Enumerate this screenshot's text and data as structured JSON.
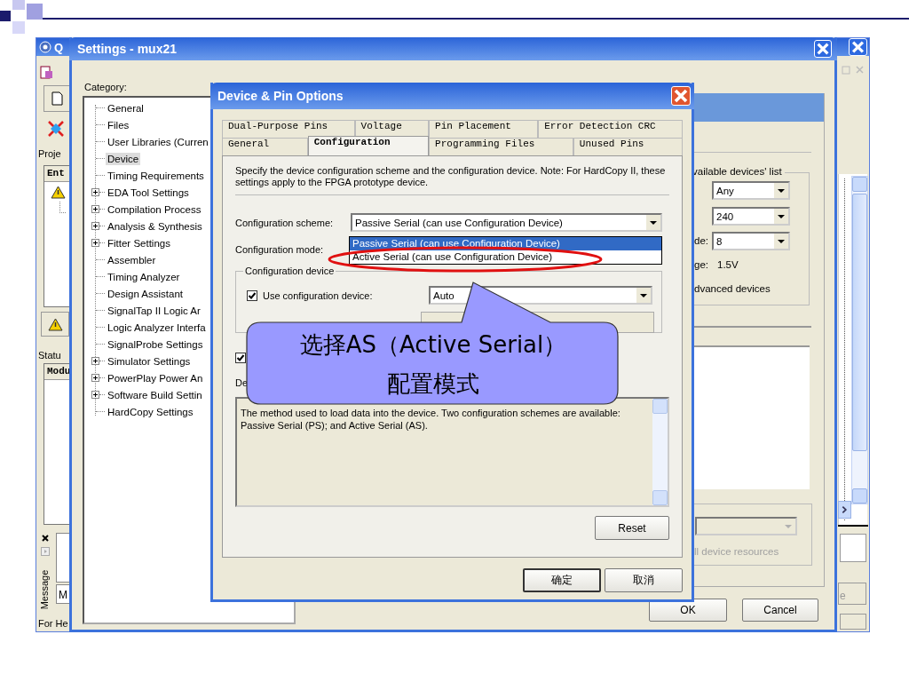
{
  "main_window": {
    "title": "Q",
    "project_label": "Proje",
    "entity_header": "Ent",
    "status_label": "Statu",
    "module_header": "Modu",
    "messages_label": "Message",
    "message_field": "M",
    "help_label": "For He",
    "button_fragment": "e"
  },
  "settings_window": {
    "title": "Settings - mux21",
    "category_label": "Category:",
    "categories": [
      {
        "label": "General",
        "expandable": false,
        "selected": false
      },
      {
        "label": "Files",
        "expandable": false,
        "selected": false
      },
      {
        "label": "User Libraries (Curren",
        "expandable": false,
        "selected": false
      },
      {
        "label": "Device",
        "expandable": false,
        "selected": true
      },
      {
        "label": "Timing Requirements",
        "expandable": false,
        "selected": false
      },
      {
        "label": "EDA Tool Settings",
        "expandable": true,
        "selected": false
      },
      {
        "label": "Compilation Process",
        "expandable": true,
        "selected": false
      },
      {
        "label": "Analysis & Synthesis",
        "expandable": true,
        "selected": false
      },
      {
        "label": "Fitter Settings",
        "expandable": true,
        "selected": false
      },
      {
        "label": "Assembler",
        "expandable": false,
        "selected": false
      },
      {
        "label": "Timing Analyzer",
        "expandable": false,
        "selected": false
      },
      {
        "label": "Design Assistant",
        "expandable": false,
        "selected": false
      },
      {
        "label": "SignalTap II Logic Ar",
        "expandable": false,
        "selected": false
      },
      {
        "label": "Logic Analyzer Interfa",
        "expandable": false,
        "selected": false
      },
      {
        "label": "SignalProbe Settings",
        "expandable": false,
        "selected": false
      },
      {
        "label": "Simulator Settings",
        "expandable": true,
        "selected": false
      },
      {
        "label": "PowerPlay Power An",
        "expandable": true,
        "selected": false
      },
      {
        "label": "Software Build Settin",
        "expandable": true,
        "selected": false
      },
      {
        "label": "HardCopy Settings",
        "expandable": false,
        "selected": false
      }
    ],
    "panel": {
      "group_title": "vailable devices' list",
      "filters": [
        {
          "value": "Any"
        },
        {
          "value": "240"
        },
        {
          "label": "de:",
          "value": "8"
        }
      ],
      "voltage": {
        "label": "ge:",
        "value": "1.5V"
      },
      "advanced_label": "dvanced devices",
      "resources": {
        "label": "ll device resources",
        "disabled": true
      }
    },
    "buttons": [
      "OK",
      "Cancel"
    ]
  },
  "device_dialog": {
    "title": "Device & Pin Options",
    "tab_rows": [
      [
        {
          "label": "Dual-Purpose Pins",
          "selected": false
        },
        {
          "label": "Voltage",
          "selected": false
        },
        {
          "label": "Pin Placement",
          "selected": false
        },
        {
          "label": "Error Detection CRC",
          "selected": false
        }
      ],
      [
        {
          "label": "General",
          "selected": false
        },
        {
          "label": "Configuration",
          "selected": true
        },
        {
          "label": "Programming Files",
          "selected": false
        },
        {
          "label": "Unused Pins",
          "selected": false
        }
      ]
    ],
    "intro": "Specify the device configuration scheme and the configuration device. Note: For HardCopy II, these settings apply to the FPGA prototype device.",
    "scheme_label": "Configuration scheme:",
    "scheme_value": "Passive Serial (can use Configuration Device)",
    "mode_label": "Configuration mode:",
    "scheme_options": [
      {
        "label": "Passive Serial (can use Configuration Device)",
        "selected": true
      },
      {
        "label": "Active Serial (can use Configuration Device)",
        "selected": false
      }
    ],
    "device_group": "Configuration device",
    "use_device": {
      "label": "Use configuration device:",
      "checked": true
    },
    "device_value": "Auto",
    "second_option": {
      "checked": true
    },
    "description_label": "De",
    "description": "The method used to load data into the device.  Two configuration schemes are available:  Passive Serial (PS); and Active Serial (AS).",
    "reset": "Reset",
    "buttons": [
      "确定",
      "取消"
    ]
  },
  "callout": {
    "lines": [
      "选择AS（Active Serial）",
      "配置模式"
    ]
  }
}
